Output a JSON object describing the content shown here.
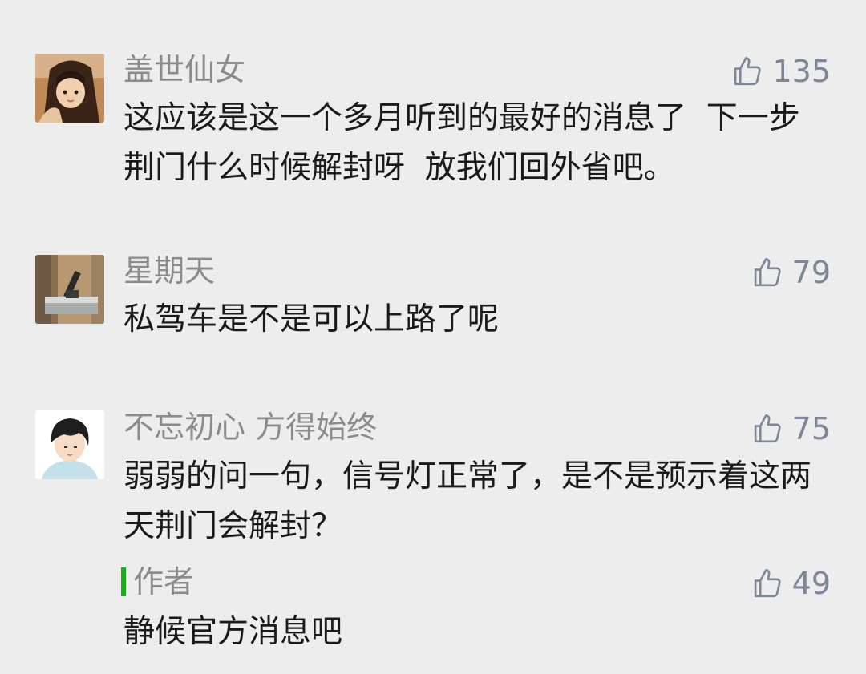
{
  "comments": [
    {
      "name": "盖世仙女",
      "likes": "135",
      "text": "这应该是这一个多月听到的最好的消息了  下一步荆门什么时候解封呀  放我们回外省吧。"
    },
    {
      "name": "星期天",
      "likes": "79",
      "text": "私驾车是不是可以上路了呢"
    },
    {
      "name": "不忘初心 方得始终",
      "likes": "75",
      "text": "弱弱的问一句，信号灯正常了，是不是预示着这两天荆门会解封？",
      "reply": {
        "name": "作者",
        "likes": "49",
        "text": "静候官方消息吧"
      }
    }
  ],
  "icons": {
    "like": "thumbs-up-icon",
    "author_marker": "green-bar"
  },
  "colors": {
    "background": "#ededed",
    "name": "#8b8b8b",
    "text": "#1a1a1a",
    "like": "#7d8797",
    "author_bar": "#19ad19"
  }
}
